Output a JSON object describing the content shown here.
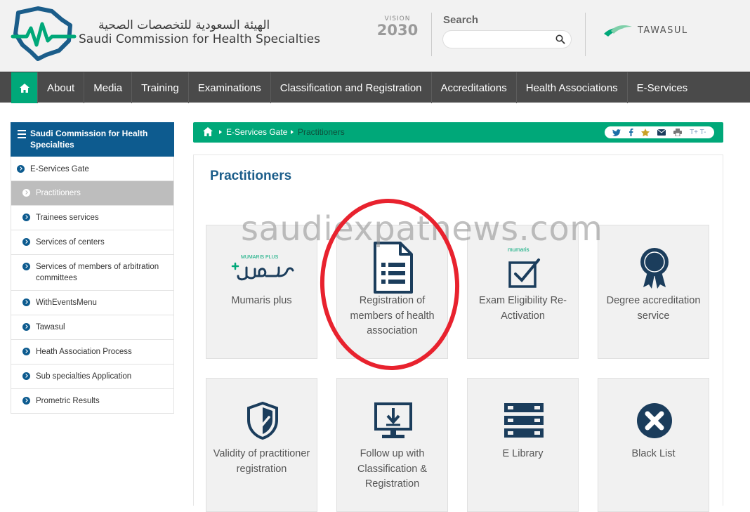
{
  "header": {
    "org_name_ar": "الهيئة السعودية للتخصصات الصحية",
    "org_name_en": "Saudi Commission for Health Specialties",
    "vision_label": "VISION",
    "vision_year": "2030",
    "search": {
      "label": "Search",
      "placeholder": ""
    },
    "tawasul_label": "TAWASUL"
  },
  "nav": {
    "items": [
      {
        "label": "About"
      },
      {
        "label": "Media"
      },
      {
        "label": "Training"
      },
      {
        "label": "Examinations"
      },
      {
        "label": "Classification and Registration"
      },
      {
        "label": "Accreditations"
      },
      {
        "label": "Health Associations"
      },
      {
        "label": "E-Services"
      }
    ]
  },
  "sidebar": {
    "title": "Saudi Commission for Health Specialties",
    "items": [
      {
        "label": "E-Services Gate"
      },
      {
        "label": "Practitioners"
      },
      {
        "label": "Trainees services"
      },
      {
        "label": "Services of centers"
      },
      {
        "label": "Services of members of arbitration committees"
      },
      {
        "label": "WithEventsMenu"
      },
      {
        "label": "Tawasul"
      },
      {
        "label": "Heath Association Process"
      },
      {
        "label": "Sub specialties Application"
      },
      {
        "label": "Prometric Results"
      }
    ]
  },
  "breadcrumb": {
    "items": [
      "E-Services Gate",
      "Practitioners"
    ],
    "tools_text": "T+ T-"
  },
  "main": {
    "title": "Practitioners",
    "watermark": "saudiexpatnews.com",
    "cards": [
      {
        "label": "Mumaris plus",
        "logo_small": "MUMARIS PLUS"
      },
      {
        "label": "Registration of members of health association"
      },
      {
        "label": "Exam Eligibility Re-Activation",
        "logo_small": "mumaris"
      },
      {
        "label": "Degree accreditation service"
      },
      {
        "label": "Validity of practitioner registration"
      },
      {
        "label": "Follow up with Classification & Registration"
      },
      {
        "label": "E Library"
      },
      {
        "label": "Black List"
      }
    ]
  },
  "colors": {
    "green": "#00a879",
    "navy": "#1b3d5c",
    "blue": "#0d5b8f",
    "annotation": "#e8222e"
  }
}
